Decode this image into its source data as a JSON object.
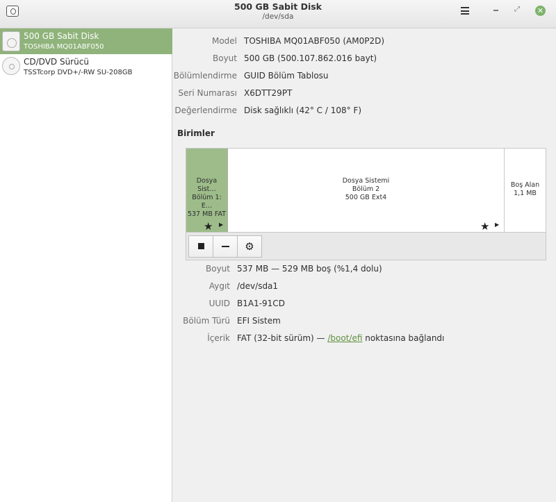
{
  "window": {
    "title": "500 GB Sabit Disk",
    "subtitle": "/dev/sda",
    "app_icon": "disks-app-icon",
    "menu_icon": "hamburger-menu-icon",
    "minimize_icon": "minimize-icon",
    "maximize_glyph": "⤢",
    "close_glyph": "✕",
    "accent_color": "#8fb37a"
  },
  "sidebar": {
    "items": [
      {
        "name": "500 GB Sabit Disk",
        "model": "TOSHIBA MQ01ABF050",
        "icon": "hard-disk-icon",
        "selected": true
      },
      {
        "name": "CD/DVD Sürücü",
        "model": "TSSTcorp DVD+/-RW SU-208GB",
        "icon": "optical-disc-icon",
        "selected": false
      }
    ]
  },
  "disk": {
    "model_label": "Model",
    "model_value": "TOSHIBA MQ01ABF050 (AM0P2D)",
    "size_label": "Boyut",
    "size_value": "500 GB (500.107.862.016 bayt)",
    "partitioning_label": "Bölümlendirme",
    "partitioning_value": "GUID Bölüm Tablosu",
    "serial_label": "Seri Numarası",
    "serial_value": "X6DTT29PT",
    "assessment_label": "Değerlendirme",
    "assessment_value": "Disk sağlıklı (42° C / 108° F)"
  },
  "volumes": {
    "title": "Birimler",
    "items": [
      {
        "line1": "Dosya Sist…",
        "line2": "Bölüm 1: E…",
        "line3": "537 MB FAT",
        "selected": true
      },
      {
        "line1": "Dosya Sistemi",
        "line2": "Bölüm 2",
        "line3": "500 GB Ext4",
        "selected": false
      },
      {
        "line1": "Boş Alan",
        "line2": "1,1 MB",
        "line3": "",
        "selected": false
      }
    ],
    "star_glyph": "★",
    "play_glyph": "▶",
    "toolbar": {
      "stop_icon": "stop-icon",
      "remove_icon": "minus-icon",
      "settings_icon": "gears-icon",
      "settings_glyph": "⚙"
    }
  },
  "partition": {
    "size_label": "Boyut",
    "size_value": "537 MB — 529 MB boş (%1,4 dolu)",
    "device_label": "Aygıt",
    "device_value": "/dev/sda1",
    "uuid_label": "UUID",
    "uuid_value": "B1A1-91CD",
    "type_label": "Bölüm Türü",
    "type_value": "EFI Sistem",
    "contents_label": "İçerik",
    "contents_prefix": "FAT (32-bit sürüm) — ",
    "contents_link": "/boot/efi",
    "contents_suffix": " noktasına bağlandı"
  }
}
